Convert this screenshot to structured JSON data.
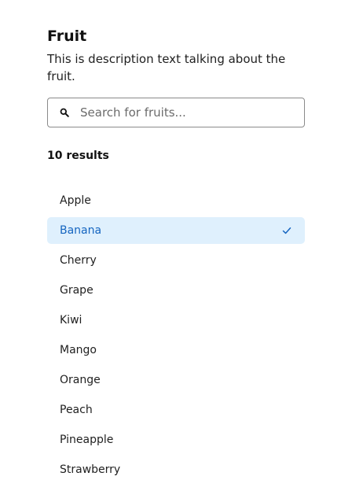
{
  "header": {
    "title": "Fruit",
    "description": "This is description text talking about the fruit."
  },
  "search": {
    "placeholder": "Search for fruits...",
    "value": "",
    "icon": "search-icon"
  },
  "results": {
    "count_label": "10 results"
  },
  "list": {
    "items": [
      {
        "label": "Apple",
        "selected": false
      },
      {
        "label": "Banana",
        "selected": true
      },
      {
        "label": "Cherry",
        "selected": false
      },
      {
        "label": "Grape",
        "selected": false
      },
      {
        "label": "Kiwi",
        "selected": false
      },
      {
        "label": "Mango",
        "selected": false
      },
      {
        "label": "Orange",
        "selected": false
      },
      {
        "label": "Peach",
        "selected": false
      },
      {
        "label": "Pineapple",
        "selected": false
      },
      {
        "label": "Strawberry",
        "selected": false
      }
    ],
    "selected_icon": "check-icon"
  },
  "colors": {
    "selected_background": "#dff0fd",
    "selected_text": "#1565c0",
    "border": "#8a8a8a"
  }
}
